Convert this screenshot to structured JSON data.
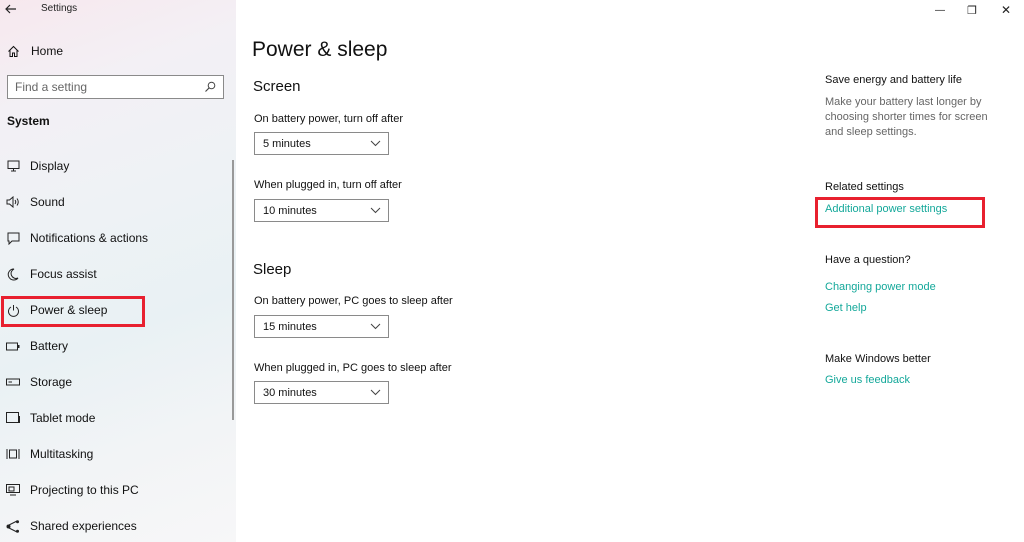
{
  "window": {
    "title": "Settings",
    "controls": {
      "minimize": "—",
      "maximize": "❐",
      "close": "✕"
    }
  },
  "sidebar": {
    "home_label": "Home",
    "search_placeholder": "Find a setting",
    "section_label": "System",
    "items": [
      {
        "label": "Display",
        "icon": "display-icon"
      },
      {
        "label": "Sound",
        "icon": "sound-icon"
      },
      {
        "label": "Notifications & actions",
        "icon": "notifications-icon"
      },
      {
        "label": "Focus assist",
        "icon": "moon-icon"
      },
      {
        "label": "Power & sleep",
        "icon": "power-icon",
        "selected": true
      },
      {
        "label": "Battery",
        "icon": "battery-icon"
      },
      {
        "label": "Storage",
        "icon": "storage-icon"
      },
      {
        "label": "Tablet mode",
        "icon": "tablet-icon"
      },
      {
        "label": "Multitasking",
        "icon": "multitasking-icon"
      },
      {
        "label": "Projecting to this PC",
        "icon": "projecting-icon"
      },
      {
        "label": "Shared experiences",
        "icon": "shared-icon"
      }
    ]
  },
  "main": {
    "title": "Power & sleep",
    "screen": {
      "heading": "Screen",
      "battery_label": "On battery power, turn off after",
      "battery_value": "5 minutes",
      "plugged_label": "When plugged in, turn off after",
      "plugged_value": "10 minutes"
    },
    "sleep": {
      "heading": "Sleep",
      "battery_label": "On battery power, PC goes to sleep after",
      "battery_value": "15 minutes",
      "plugged_label": "When plugged in, PC goes to sleep after",
      "plugged_value": "30 minutes"
    }
  },
  "right": {
    "save_heading": "Save energy and battery life",
    "save_text": "Make your battery last longer by choosing shorter times for screen and sleep settings.",
    "related_heading": "Related settings",
    "additional_link": "Additional power settings",
    "question_heading": "Have a question?",
    "changing_link": "Changing power mode",
    "help_link": "Get help",
    "better_heading": "Make Windows better",
    "feedback_link": "Give us feedback"
  },
  "colors": {
    "accent_link": "#14a89a",
    "highlight_red": "#e8202f"
  }
}
